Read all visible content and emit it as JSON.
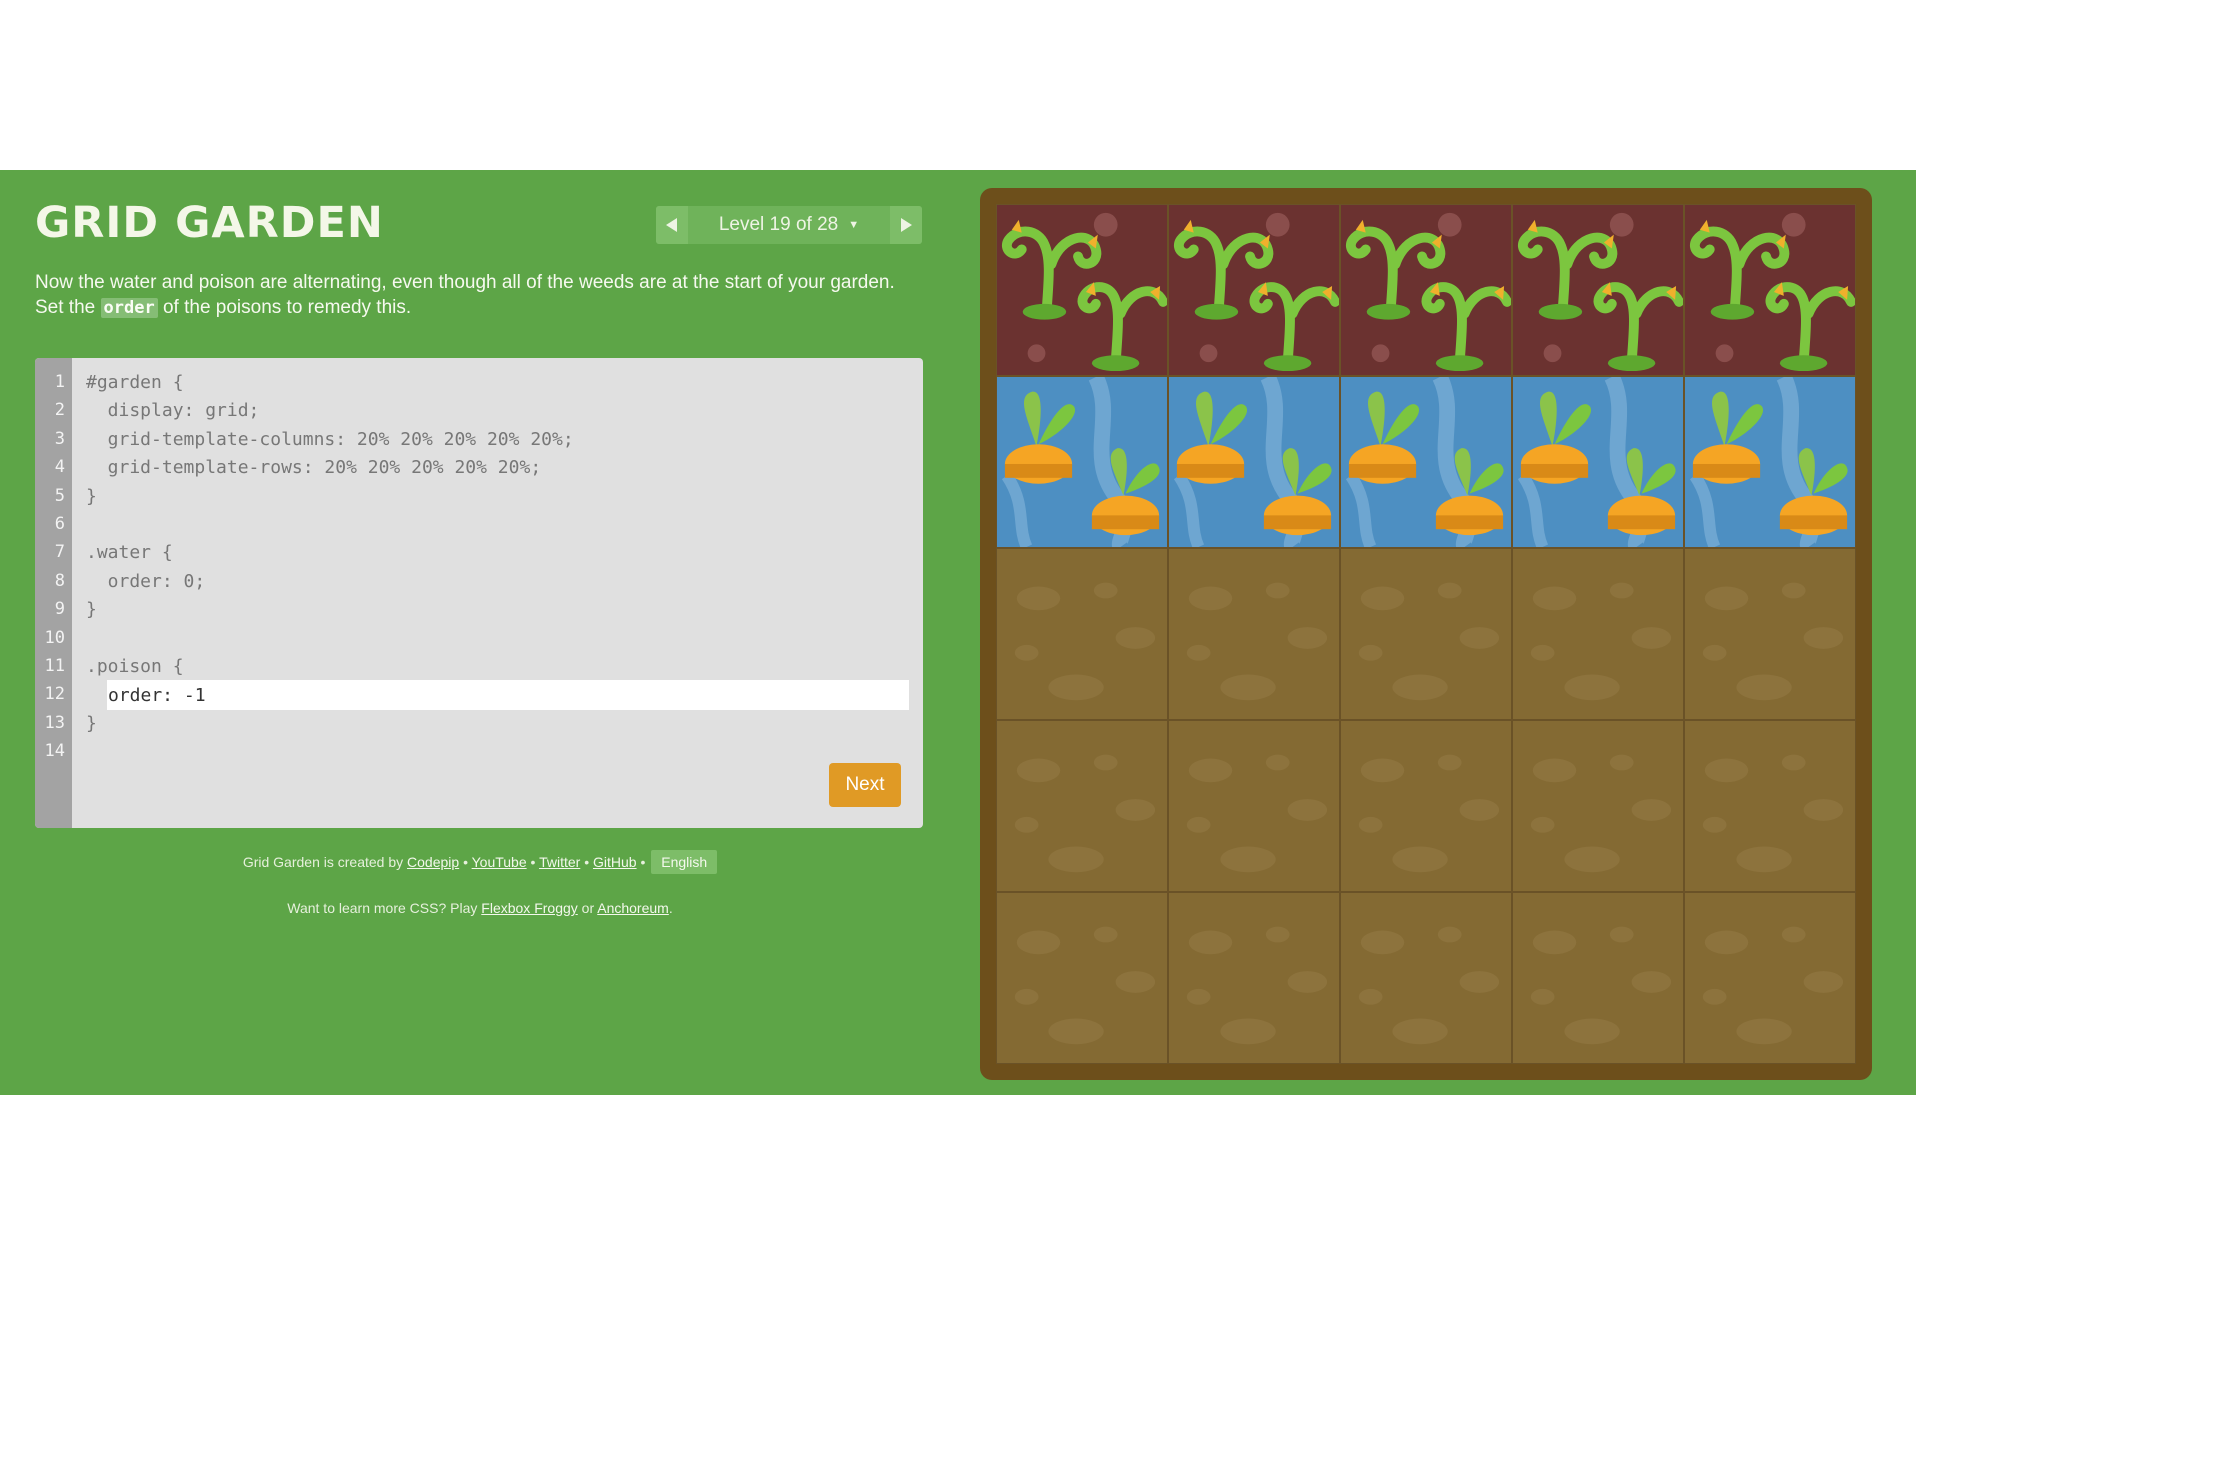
{
  "app": {
    "title": "GRID GARDEN",
    "level_label": "Level 19 of 28",
    "instructions_before": "Now the water and poison are alternating, even though all of the weeds are at the start of your garden. Set the",
    "instructions_keyword": "order",
    "instructions_after": "of the poisons to remedy this."
  },
  "editor": {
    "line_numbers": [
      "1",
      "2",
      "3",
      "4",
      "5",
      "6",
      "7",
      "8",
      "9",
      "10",
      "11",
      "12",
      "13",
      "14"
    ],
    "lines": [
      "#garden {",
      "  display: grid;",
      "  grid-template-columns: 20% 20% 20% 20% 20%;",
      "  grid-template-rows: 20% 20% 20% 20% 20%;",
      "}",
      "",
      ".water {",
      "  order: 0;",
      "}",
      "",
      ".poison {",
      "",
      "}",
      ""
    ],
    "input_value": "order: -1",
    "next_label": "Next"
  },
  "footer": {
    "credit_prefix": "Grid Garden is created by",
    "links": [
      "Codepip",
      "YouTube",
      "Twitter",
      "GitHub"
    ],
    "separator": "•",
    "language": "English",
    "learn_prefix": "Want to learn more CSS? Play",
    "learn_link_1": "Flexbox Froggy",
    "learn_or": "or",
    "learn_link_2": "Anchoreum",
    "learn_suffix": "."
  },
  "garden": {
    "rows": [
      "weed",
      "water",
      "soil",
      "soil",
      "soil"
    ],
    "columns": 5
  },
  "colors": {
    "background": "#5da547",
    "accent": "#e09a25",
    "weed_tile": "#6b3230",
    "water_tile": "#4d8fc2",
    "soil_tile": "#846a33",
    "frame": "#6d4f1b"
  },
  "icons": {
    "prev": "triangle-left-icon",
    "next": "triangle-right-icon",
    "caret": "caret-down-icon"
  }
}
